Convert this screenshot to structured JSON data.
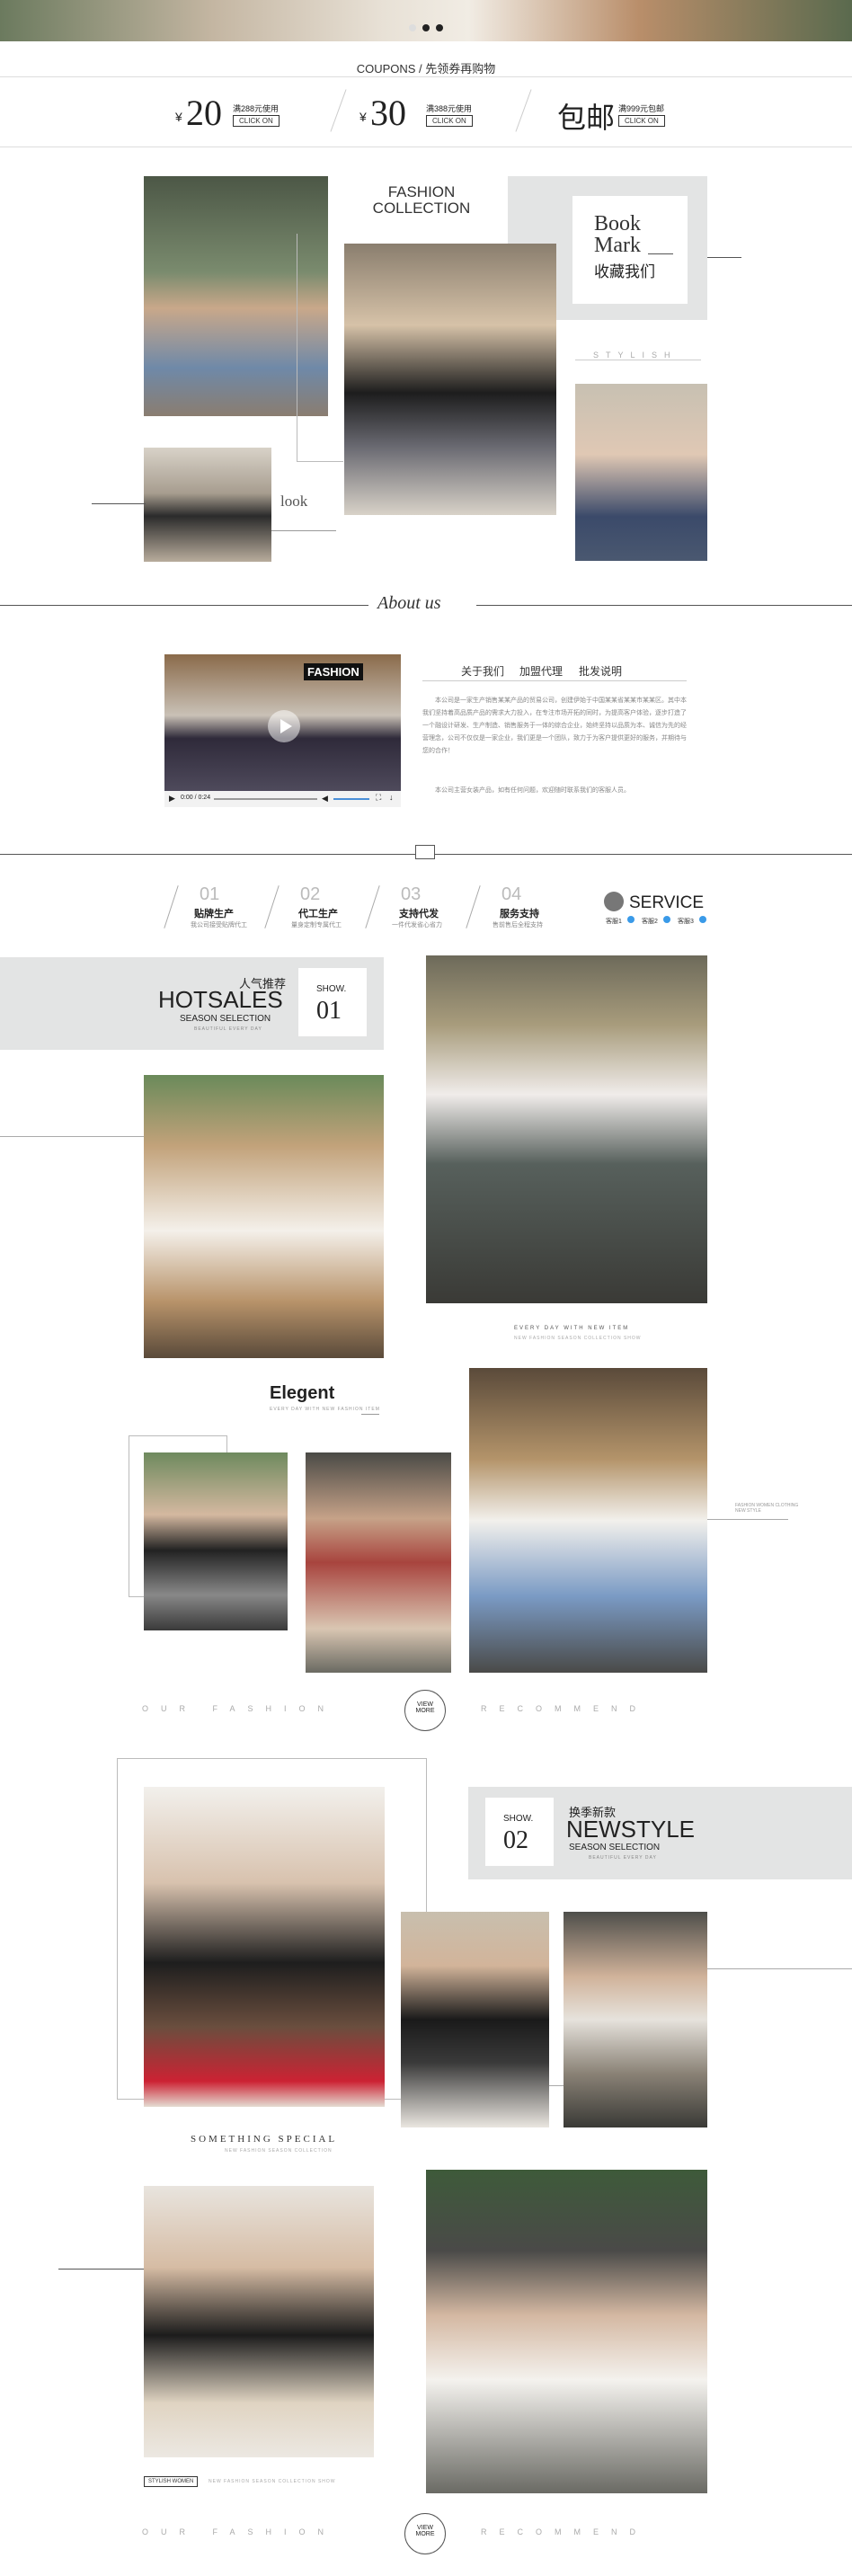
{
  "banner": {
    "dots": 3,
    "active_dot": 1
  },
  "coupons": {
    "title": "COUPONS / 先领券再购物",
    "items": [
      {
        "symbol": "¥",
        "amount": "20",
        "condition": "满288元使用",
        "button": "CLICK ON"
      },
      {
        "symbol": "¥",
        "amount": "30",
        "condition": "满388元使用",
        "button": "CLICK ON"
      },
      {
        "symbol": "",
        "amount": "包邮",
        "condition": "满999元包邮",
        "button": "CLICK ON"
      }
    ]
  },
  "fashion": {
    "title_line1": "FASHION",
    "title_line2": "COLLECTION",
    "bookmark_en1": "Book",
    "bookmark_en2": "Mark",
    "bookmark_cn": "收藏我们",
    "stylish": "STYLISH",
    "look": "look"
  },
  "about": {
    "heading": "About us",
    "video_time": "0:00 / 0:24",
    "store_sign": "FASHION",
    "tabs": [
      "关于我们",
      "加盟代理",
      "批发说明"
    ],
    "paragraph1": "本公司是一家生产销售某某产品的贸易公司，创建伊始于中国某某省某某市某某区。其中本我们坚持着高品质产品的需求大力投入，在专注市场开拓的同时，为提高客户体验，逐步打造了一个融设计研发、生产制造、销售服务于一体的综合企业，始终坚持以品质为本、诚信为先的经营理念，公司不仅仅是一家企业，我们更是一个团队，致力于为客户提供更好的服务，并期待与您的合作！",
    "paragraph2": "本公司主营女装产品，如有任何问题，欢迎随时联系我们的客服人员。"
  },
  "services": {
    "items": [
      {
        "num": "01",
        "title": "贴牌生产",
        "desc": "我公司接受贴牌代工"
      },
      {
        "num": "02",
        "title": "代工生产",
        "desc": "量身定制专属代工"
      },
      {
        "num": "03",
        "title": "支持代发",
        "desc": "一件代发省心省力"
      },
      {
        "num": "04",
        "title": "服务支持",
        "desc": "售前售后全程支持"
      }
    ],
    "service_label": "SERVICE",
    "qq_labels": [
      "客服1",
      "客服2",
      "客服3"
    ]
  },
  "hotsales": {
    "cn": "人气推荐",
    "en": "HOTSALES",
    "sub": "SEASON SELECTION",
    "tiny": "BEAUTIFUL EVERY DAY",
    "show": "SHOW.",
    "num": "01",
    "caption": "EVERY DAY WITH NEW ITEM",
    "caption_small": "NEW FASHION SEASON COLLECTION SHOW"
  },
  "elegent": {
    "title": "Elegent",
    "sub": "EVERY DAY WITH NEW FASHION ITEM",
    "side_note": "FASHION WOMEN CLOTHING NEW STYLE"
  },
  "recommend": {
    "left": "OUR FASHION",
    "right": "RECOMMEND",
    "btn1": "VIEW",
    "btn2": "MORE"
  },
  "newstyle": {
    "cn": "换季新款",
    "en": "NEWSTYLE",
    "sub": "SEASON SELECTION",
    "tiny": "BEAUTIFUL EVERY DAY",
    "show": "SHOW.",
    "num": "02",
    "special": "SOMETHING SPECIAL",
    "special_small": "NEW FASHION SEASON COLLECTION",
    "stylish_tag": "STYLISH WOMEN",
    "stylish_small": "NEW FASHION SEASON COLLECTION SHOW"
  },
  "colors": {
    "grey_panel": "#e3e4e4",
    "text_dark": "#222222",
    "photo_tones": [
      "#7b6a5a",
      "#c9b8a6",
      "#3d4a3a",
      "#e8dcc8",
      "#a89886"
    ]
  }
}
